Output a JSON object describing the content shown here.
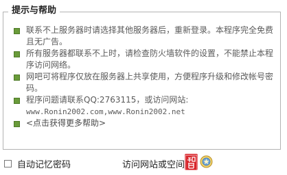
{
  "groupbox": {
    "title": "提示与帮助"
  },
  "tips": [
    {
      "text": "联系不上服务器时请选择其他服务器后，重新登录。本程序完全免费且无广告。"
    },
    {
      "text": "所有服务器都联系不上时，请检查防火墙软件的设置，不能禁止本程序访问网络。"
    },
    {
      "text": "网吧可将程序仅放在服务器上共享使用，方便程序升级和修改帐号密码。"
    },
    {
      "text": "程序问题请联系QQ:2763115，或访问网站:",
      "mono": "www.Ronin2002.com,www.Ronin2002.net"
    },
    {
      "text": "<点击获得更多帮助>"
    }
  ],
  "bottom": {
    "remember_label": "自动记忆密码",
    "remember_checked": false,
    "visit_label": "访问网站或空间"
  },
  "colors": {
    "bullet": "#6a9b3a",
    "seal": "#d8262c"
  },
  "icons": {
    "seal": "red-seal-icon",
    "badge": "qzone-badge-icon"
  }
}
